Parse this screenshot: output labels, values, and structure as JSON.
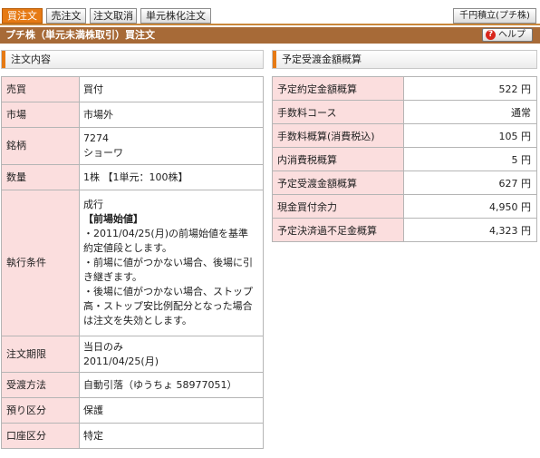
{
  "tabs": [
    "買注文",
    "売注文",
    "注文取消",
    "単元株化注文"
  ],
  "tab_right": "千円積立(プチ株)",
  "title": "プチ株（単元未満株取引）買注文",
  "help_label": "ヘルプ",
  "left": {
    "header": "注文内容",
    "rows": {
      "baibai": {
        "label": "売買",
        "value": "買付"
      },
      "shijou": {
        "label": "市場",
        "value": "市場外"
      },
      "meigara": {
        "label": "銘柄",
        "code": "7274",
        "name": "ショーワ"
      },
      "suryo": {
        "label": "数量",
        "value": "1株 【1単元：100株】"
      },
      "shikko": {
        "label": "執行条件",
        "line1": "成行",
        "line2": "【前場始値】",
        "line3": "・2011/04/25(月)の前場始値を基準",
        "line4": "約定値段とします。",
        "line5": "・前場に値がつかない場合、後場に引",
        "line6": "き継ぎます。",
        "line7": "・後場に値がつかない場合、ストップ",
        "line8": "高・ストップ安比例配分となった場合",
        "line9": "は注文を失効とします。"
      },
      "kigen": {
        "label": "注文期限",
        "line1": "当日のみ",
        "line2": "2011/04/25(月)"
      },
      "uketori": {
        "label": "受渡方法",
        "value": "自動引落（ゆうちょ 58977051）"
      },
      "azukari": {
        "label": "預り区分",
        "value": "保護"
      },
      "koza": {
        "label": "口座区分",
        "value": "特定"
      }
    }
  },
  "right": {
    "header": "予定受渡金額概算",
    "rows": [
      {
        "label": "予定約定金額概算",
        "value": "522 円"
      },
      {
        "label": "手数料コース",
        "value": "通常"
      },
      {
        "label": "手数料概算(消費税込)",
        "value": "105 円"
      },
      {
        "label": "内消費税概算",
        "value": "5 円"
      },
      {
        "label": "予定受渡金額概算",
        "value": "627 円"
      },
      {
        "label": "現金買付余力",
        "value": "4,950 円"
      },
      {
        "label": "予定決済過不足金概算",
        "value": "4,323 円"
      }
    ]
  }
}
